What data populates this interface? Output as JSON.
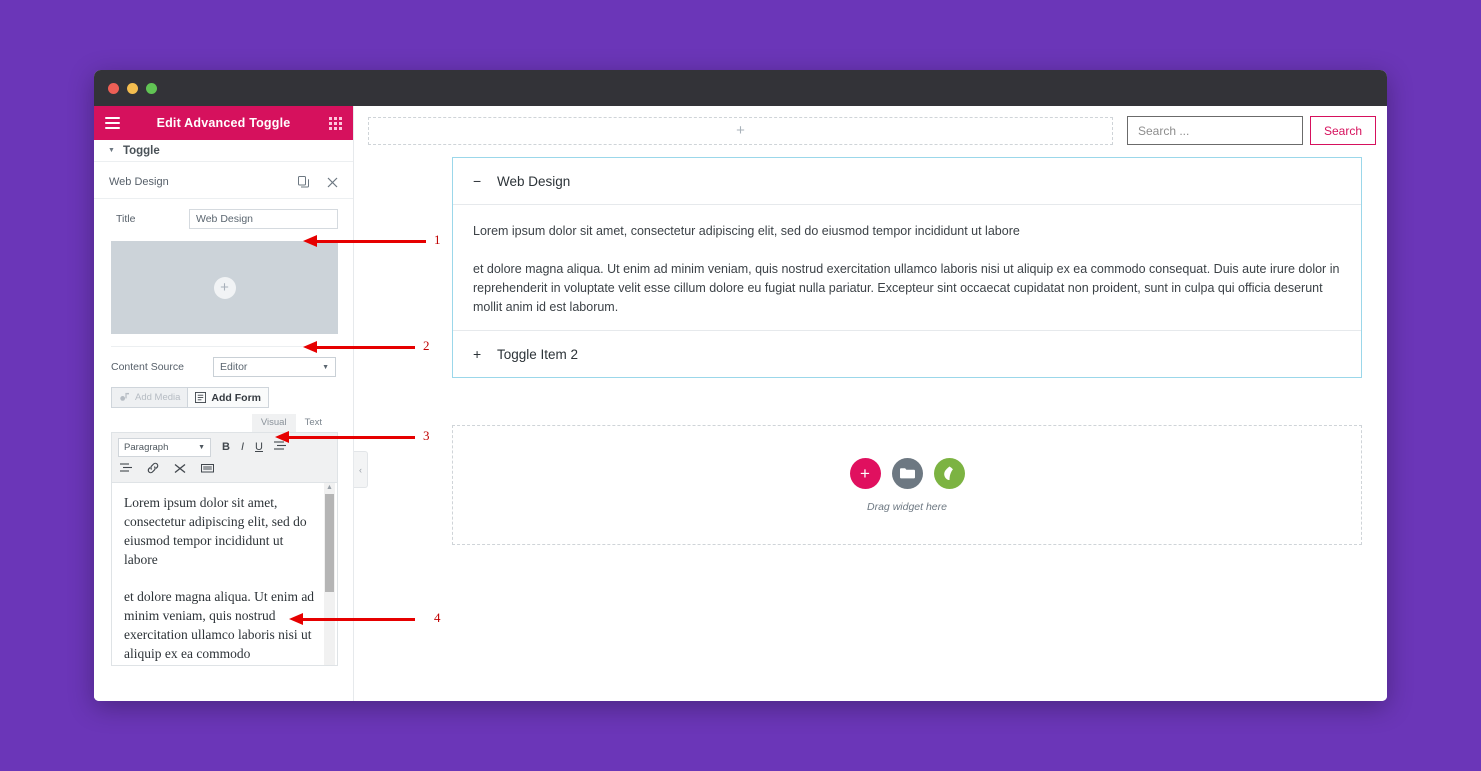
{
  "window": {
    "traffic_lights": [
      "close",
      "minimize",
      "maximize"
    ]
  },
  "panel": {
    "header": {
      "title": "Edit Advanced Toggle",
      "menu_icon": "hamburger-icon",
      "grid_icon": "grid-icon"
    },
    "section": {
      "label": "Toggle",
      "caret": "▼"
    },
    "item": {
      "name": "Web Design",
      "duplicate_icon": "duplicate-icon",
      "close_icon": "close-icon"
    },
    "title_field": {
      "label": "Title",
      "value": "Web Design",
      "placeholder": "Title"
    },
    "image_placeholder": {
      "plus": "+"
    },
    "content_source": {
      "label": "Content Source",
      "value": "Editor",
      "caret": "▼",
      "options": [
        "Editor"
      ]
    },
    "buttons": {
      "add_media": "Add Media",
      "add_form": "Add Form"
    },
    "editor_tabs": {
      "visual": "Visual",
      "text": "Text",
      "active": "Visual"
    },
    "editor_toolbar": {
      "format_select": "Paragraph",
      "format_caret": "▼",
      "row1": [
        "bold-icon",
        "italic-icon",
        "underline-icon",
        "bullet-list-icon"
      ],
      "row1_glyphs": [
        "B",
        "I",
        "U",
        "☰"
      ],
      "row2": [
        "numbered-list-icon",
        "link-icon",
        "read-more-icon",
        "keyboard-icon"
      ],
      "row2_glyphs": [
        "☷",
        "🔗",
        "✖",
        "⌨"
      ]
    },
    "editor_content": {
      "paragraphs": [
        "Lorem ipsum dolor sit amet, consectetur adipiscing elit, sed do eiusmod tempor incididunt ut labore",
        "et dolore magna aliqua. Ut enim ad minim veniam, quis nostrud exercitation ullamco laboris nisi ut aliquip ex ea commodo"
      ]
    }
  },
  "canvas": {
    "add_section": {
      "plus": "+"
    },
    "search": {
      "placeholder": "Search ...",
      "value": "",
      "button_label": "Search"
    },
    "collapse_handle": {
      "icon": "chevron-left-icon",
      "glyph": "‹"
    },
    "accordion": {
      "items": [
        {
          "sign": "−",
          "title": "Web Design",
          "expanded": true,
          "paragraphs": [
            "Lorem ipsum dolor sit amet, consectetur adipiscing elit, sed do eiusmod tempor incididunt ut labore",
            "et dolore magna aliqua. Ut enim ad minim veniam, quis nostrud exercitation ullamco laboris nisi ut aliquip ex ea commodo consequat. Duis aute irure dolor in reprehenderit in voluptate velit esse cillum dolore eu fugiat nulla pariatur. Excepteur sint occaecat cupidatat non proident, sunt in culpa qui officia deserunt mollit anim id est laborum."
          ]
        },
        {
          "sign": "+",
          "title": "Toggle Item 2",
          "expanded": false,
          "paragraphs": []
        }
      ]
    },
    "drop_zone": {
      "label": "Drag widget here",
      "icons": [
        "add-widget-icon",
        "folder-icon",
        "leaf-icon"
      ],
      "add_glyph": "+"
    }
  },
  "annotations": [
    {
      "number": "1"
    },
    {
      "number": "2"
    },
    {
      "number": "3"
    },
    {
      "number": "4"
    }
  ],
  "colors": {
    "background": "#6b36b8",
    "panel_header": "#d6115d",
    "accent_pink": "#e0105f",
    "accordion_border": "#9bd7ea",
    "annotation_red": "#e60000",
    "leaf_green": "#7cb342"
  }
}
